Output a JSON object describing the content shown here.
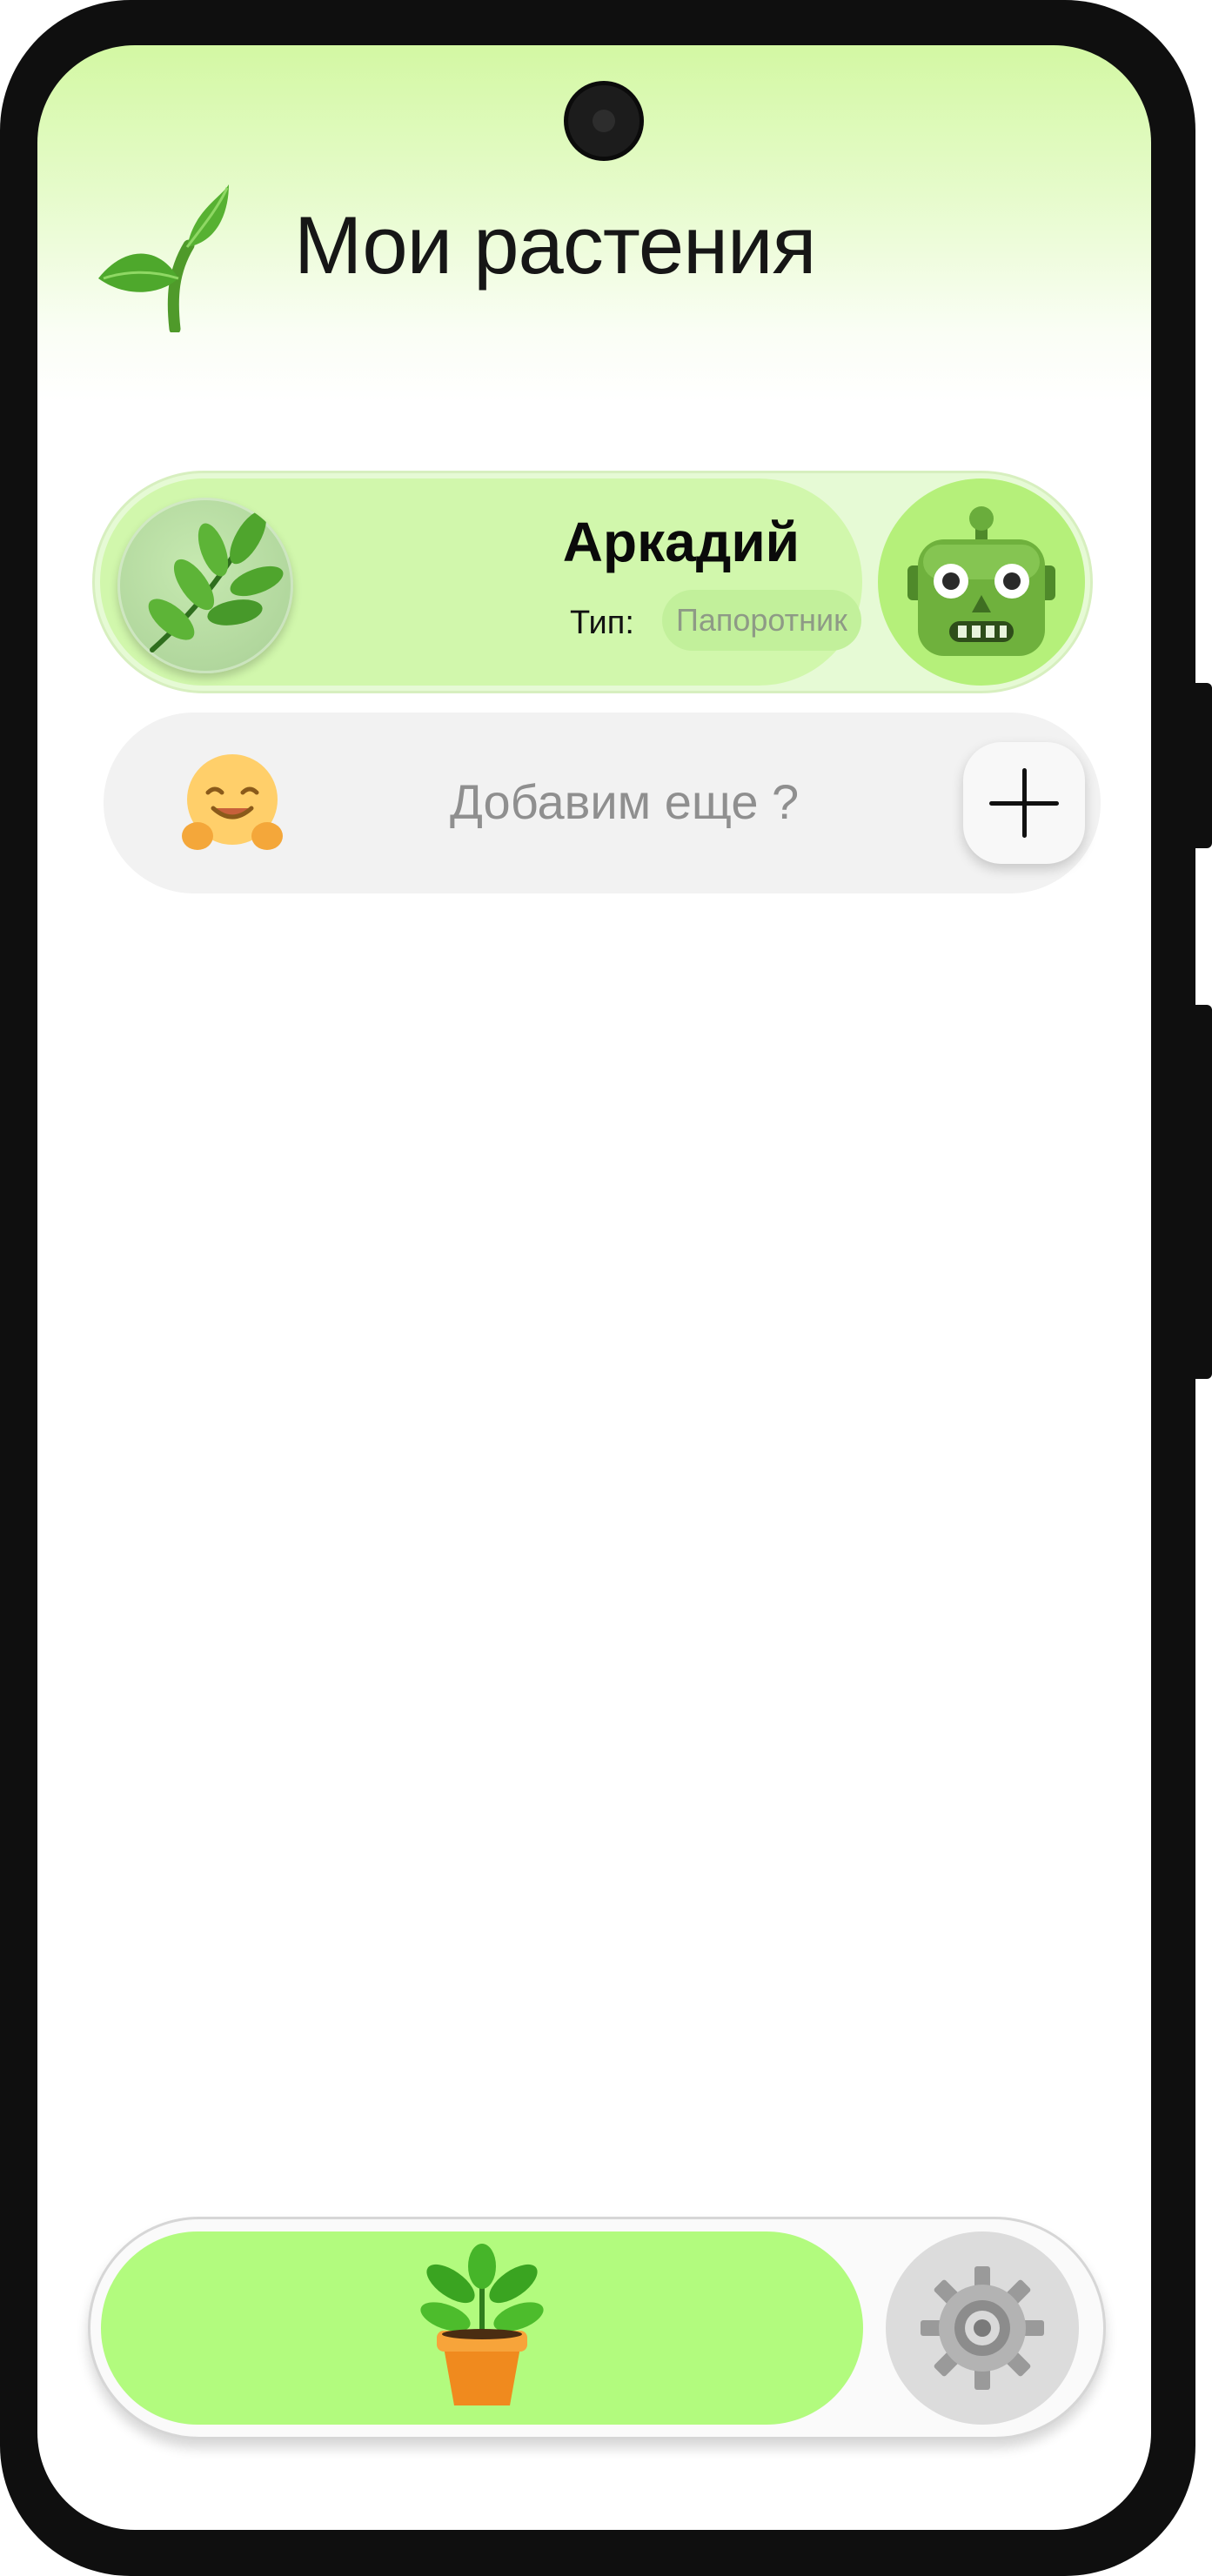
{
  "header": {
    "title": "Мои растения",
    "icon": "seedling-icon"
  },
  "plants": [
    {
      "name": "Аркадий",
      "type_label": "Тип:",
      "type_value": "Папоротник",
      "avatar_icon": "herb-icon",
      "assistant_icon": "robot-icon"
    }
  ],
  "add_card": {
    "text": "Добавим еще ?",
    "icon": "hugging-face-icon",
    "button_icon": "plus-icon"
  },
  "bottom_nav": {
    "items": [
      {
        "id": "plants",
        "icon": "potted-plant-icon",
        "active": true
      },
      {
        "id": "settings",
        "icon": "gear-icon",
        "active": false
      }
    ]
  },
  "colors": {
    "accent": "#b2fb7e",
    "card_bg": "#d1f7ac",
    "header_gradient_top": "#d3f8a3"
  }
}
